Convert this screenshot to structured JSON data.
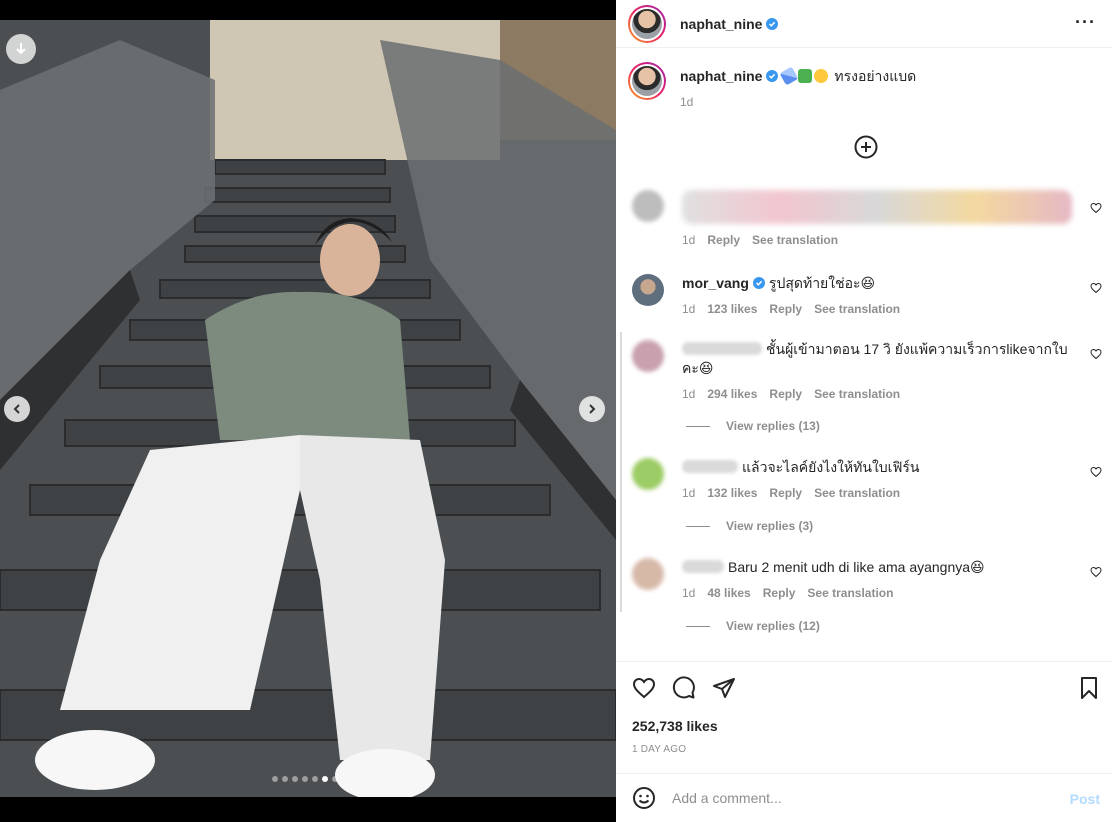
{
  "post": {
    "username": "naphat_nine",
    "caption_text": "ทรงอย่างแบด",
    "caption_time": "1d",
    "likes": "252,738 likes",
    "date": "1 DAY AGO"
  },
  "media": {
    "slide_count": 7,
    "active_slide_index": 5
  },
  "comments": [
    {
      "user": "",
      "text": "",
      "time": "1d",
      "likes": "",
      "reply": "Reply",
      "translate": "See translation"
    },
    {
      "user": "mor_vang",
      "text": "รูปสุดท้ายใช่อะ😆",
      "time": "1d",
      "likes": "123 likes",
      "reply": "Reply",
      "translate": "See translation"
    },
    {
      "user": "",
      "text": "ชั้นผู้เข้ามาตอน 17 วิ ยังแพ้ความเร็วการlikeจากใบคะ😆",
      "time": "1d",
      "likes": "294 likes",
      "reply": "Reply",
      "translate": "See translation",
      "view_replies": "View replies (13)"
    },
    {
      "user": "",
      "text": "แล้วจะไลค์ยังไงให้ทันใบเฟิร์น",
      "time": "1d",
      "likes": "132 likes",
      "reply": "Reply",
      "translate": "See translation",
      "view_replies": "View replies (3)"
    },
    {
      "user": "",
      "text": "Baru 2 menit udh di like ama ayangnya😆",
      "time": "1d",
      "likes": "48 likes",
      "reply": "Reply",
      "translate": "See translation",
      "view_replies": "View replies (12)"
    }
  ],
  "add_comment": {
    "placeholder": "Add a comment...",
    "post_label": "Post"
  },
  "colors": {
    "verified": "#3897f0",
    "secondary_text": "#8e8e8e",
    "post_button_disabled": "#b3dbff"
  }
}
